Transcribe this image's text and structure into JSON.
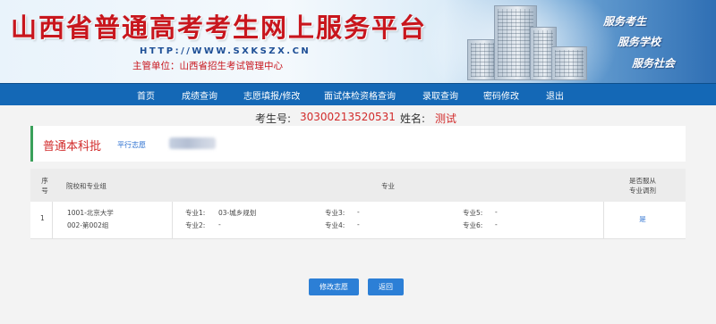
{
  "header": {
    "title": "山西省普通高考考生网上服务平台",
    "url": "HTTP://WWW.SXKSZX.CN",
    "organizer": "主管单位：山西省招生考试管理中心",
    "slogans": [
      "服务考生",
      "服务学校",
      "服务社会"
    ]
  },
  "nav": {
    "items": [
      "首页",
      "成绩查询",
      "志愿填报/修改",
      "面试体检资格查询",
      "录取查询",
      "密码修改",
      "退出"
    ]
  },
  "student": {
    "id_label": "考生号:",
    "id_value": "30300213520531",
    "name_label": "姓名:",
    "name_value": "测试"
  },
  "batch": {
    "title": "普通本科批",
    "tag": "平行志愿"
  },
  "table": {
    "headers": {
      "index": [
        "序",
        "号"
      ],
      "school": "院校和专业组",
      "major": "专业",
      "adjust": [
        "是否服从",
        "专业调剂"
      ]
    },
    "rows": [
      {
        "index": "1",
        "school_line1": "1001-北京大学",
        "school_line2": "002-第002组",
        "majors": [
          {
            "label": "专业1:",
            "value": "03-城乡规划"
          },
          {
            "label": "专业2:",
            "value": "-"
          },
          {
            "label": "专业3:",
            "value": "-"
          },
          {
            "label": "专业4:",
            "value": "-"
          },
          {
            "label": "专业5:",
            "value": "-"
          },
          {
            "label": "专业6:",
            "value": "-"
          }
        ],
        "adjust": "是"
      }
    ]
  },
  "buttons": {
    "modify": "修改志愿",
    "back": "返回"
  },
  "colors": {
    "title_red": "#c8161d",
    "nav_blue": "#1468b6",
    "button_blue": "#2c7fd6",
    "accent_green": "#3aa05a",
    "value_red": "#d22b2b"
  }
}
